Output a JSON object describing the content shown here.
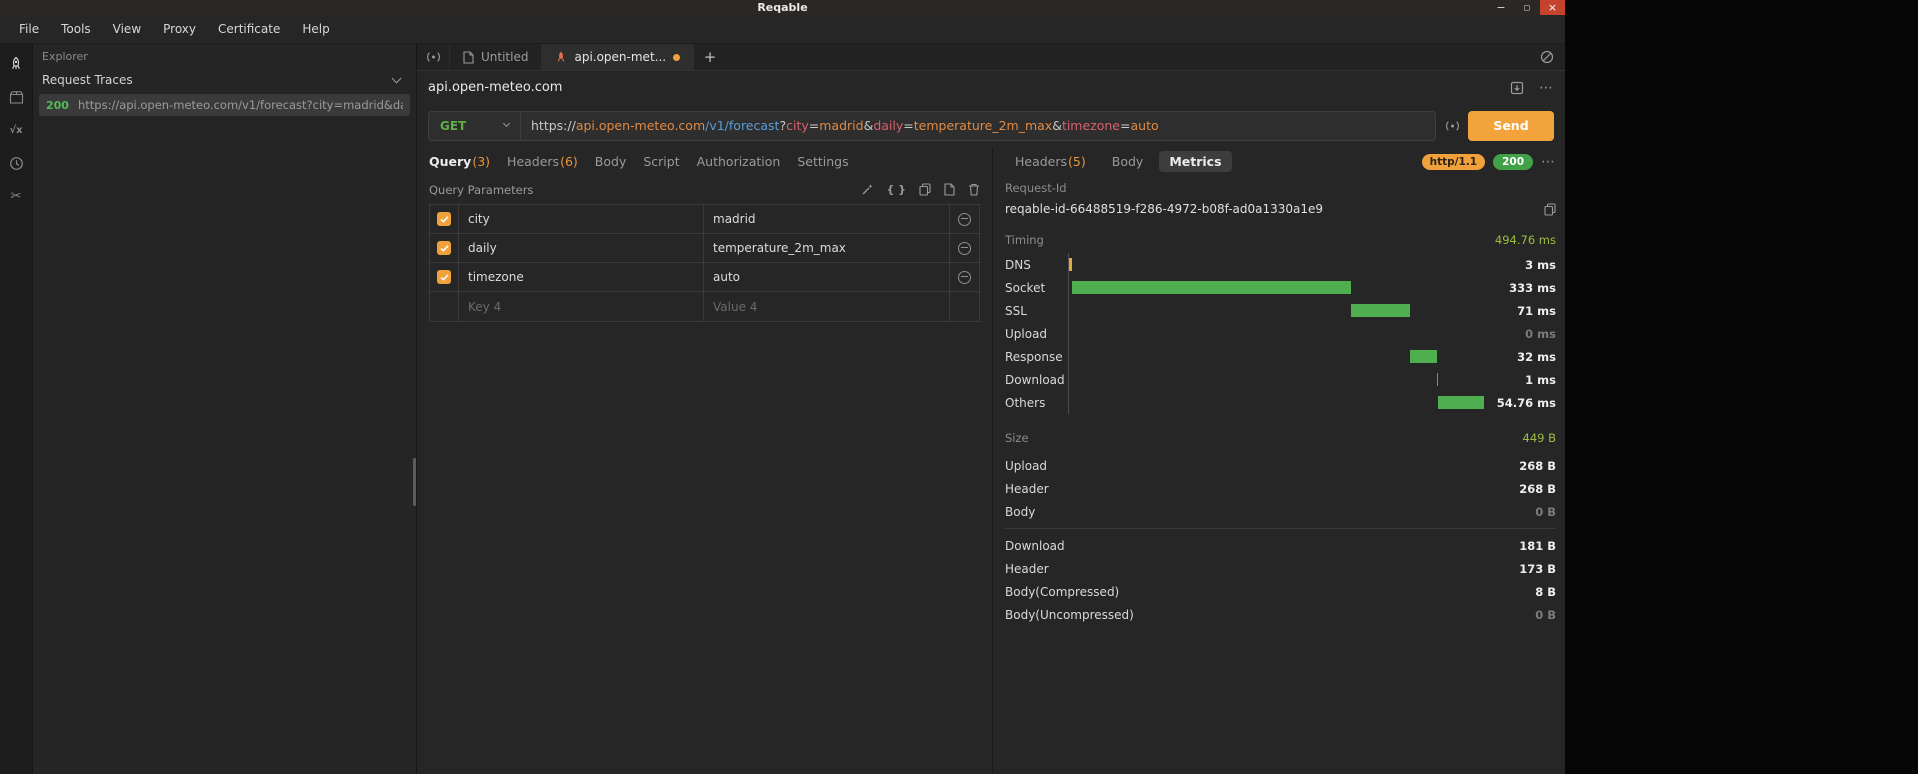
{
  "window": {
    "title": "Reqable"
  },
  "icons": {
    "minimize": "−",
    "maximize": "◻",
    "close": "×",
    "more": "⋯",
    "plus": "+",
    "braces": "{ }",
    "functions": "√x",
    "scissors": "✂"
  },
  "menu": {
    "items": [
      "File",
      "Tools",
      "View",
      "Proxy",
      "Certificate",
      "Help"
    ]
  },
  "explorer": {
    "title": "Explorer",
    "section": "Request Traces",
    "trace": {
      "status": "200",
      "url": "https://api.open-meteo.com/v1/forecast?city=madrid&daily=te..."
    }
  },
  "tabs": {
    "items": [
      {
        "label": "Untitled",
        "active": false,
        "modified": false
      },
      {
        "label": "api.open-met...",
        "active": true,
        "modified": true
      }
    ]
  },
  "request": {
    "host": "api.open-meteo.com",
    "method": "GET",
    "send_label": "Send",
    "url_segments": [
      {
        "text": "https://",
        "color": "#c9c9c9"
      },
      {
        "text": "api.open-meteo.com",
        "color": "#e08a43"
      },
      {
        "text": "/v1/forecast",
        "color": "#5b9bd5"
      },
      {
        "text": "?",
        "color": "#c9c9c9"
      },
      {
        "text": "city",
        "color": "#d8606e"
      },
      {
        "text": "=",
        "color": "#c9c9c9"
      },
      {
        "text": "madrid",
        "color": "#e08a43"
      },
      {
        "text": "&",
        "color": "#c9c9c9"
      },
      {
        "text": "daily",
        "color": "#d8606e"
      },
      {
        "text": "=",
        "color": "#c9c9c9"
      },
      {
        "text": "temperature_2m_max",
        "color": "#e08a43"
      },
      {
        "text": "&",
        "color": "#c9c9c9"
      },
      {
        "text": "timezone",
        "color": "#d8606e"
      },
      {
        "text": "=",
        "color": "#c9c9c9"
      },
      {
        "text": "auto",
        "color": "#e08a43"
      }
    ]
  },
  "request_tabs": [
    {
      "label": "Query",
      "count": "(3)",
      "active": true
    },
    {
      "label": "Headers",
      "count": "(6)",
      "active": false
    },
    {
      "label": "Body",
      "active": false
    },
    {
      "label": "Script",
      "active": false
    },
    {
      "label": "Authorization",
      "active": false
    },
    {
      "label": "Settings",
      "active": false
    }
  ],
  "query_params": {
    "title": "Query Parameters",
    "rows": [
      {
        "key": "city",
        "value": "madrid",
        "checked": true
      },
      {
        "key": "daily",
        "value": "temperature_2m_max",
        "checked": true
      },
      {
        "key": "timezone",
        "value": "auto",
        "checked": true
      }
    ],
    "placeholder_row": {
      "key": "Key 4",
      "value": "Value 4"
    }
  },
  "response": {
    "tabs": [
      {
        "label": "Headers",
        "count": "(5)",
        "active": false
      },
      {
        "label": "Body",
        "active": false
      },
      {
        "label": "Metrics",
        "active": true
      }
    ],
    "http_badge": "http/1.1",
    "status_badge": "200",
    "request_id_label": "Request-Id",
    "request_id": "reqable-id-66488519-f286-4972-b08f-ad0a1330a1e9",
    "timing": {
      "label": "Timing",
      "total": "494.76 ms",
      "total_ms": 494.76,
      "rows": [
        {
          "label": "DNS",
          "value": "3 ms",
          "ms": 3,
          "bar_color": "#e2aa3c"
        },
        {
          "label": "Socket",
          "value": "333 ms",
          "ms": 333
        },
        {
          "label": "SSL",
          "value": "71 ms",
          "ms": 71
        },
        {
          "label": "Upload",
          "value": "0 ms",
          "ms": 0
        },
        {
          "label": "Response",
          "value": "32 ms",
          "ms": 32
        },
        {
          "label": "Download",
          "value": "1 ms",
          "ms": 1
        },
        {
          "label": "Others",
          "value": "54.76 ms",
          "ms": 54.76
        }
      ]
    },
    "size": {
      "label": "Size",
      "total": "449 B",
      "groups": [
        [
          {
            "label": "Upload",
            "value": "268 B"
          },
          {
            "label": "Header",
            "value": "268 B"
          },
          {
            "label": "Body",
            "value": "0 B"
          }
        ],
        [
          {
            "label": "Download",
            "value": "181 B"
          },
          {
            "label": "Header",
            "value": "173 B"
          },
          {
            "label": "Body(Compressed)",
            "value": "8 B"
          },
          {
            "label": "Body(Uncompressed)",
            "value": "0 B"
          }
        ]
      ]
    }
  },
  "colors": {
    "accent_orange": "#f0a13c",
    "bar_green": "#4fae50",
    "method_green": "#5fae4a",
    "status_green": "#42a049",
    "total_green": "#9dbd3f"
  }
}
